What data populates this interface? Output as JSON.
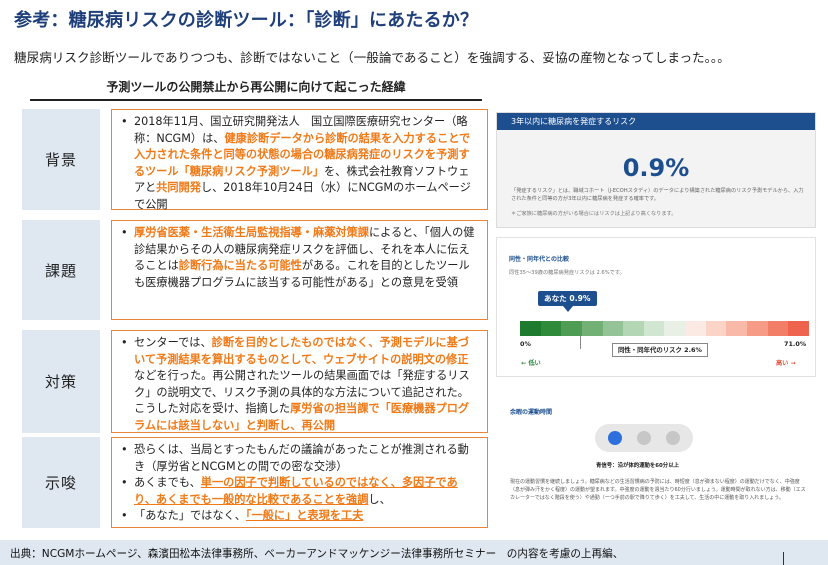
{
  "title": "参考：糖尿病リスクの診断ツール：「診断」にあたるか？",
  "subtitle": "糖尿病リスク診断ツールでありつつも、診断ではないこと（一般論であること）を強調する、妥協の産物となってしまった。。。",
  "section_heading": "予測ツールの公開禁止から再公開に向けて起こった経緯",
  "rows": [
    {
      "label": "背景",
      "text": [
        "2018年11月、国立研究開発法人　国立国際医療研究センター（略称：NCGM）は、",
        "健康診断データから診断の結果を入力することで入力された条件と同等の状態の場合の糖尿病発症のリスクを予測するツール「糖尿病リスク予測ツール」",
        "を、株式会社教育ソフトウェアと",
        "共同開発",
        "し、2018年10月24日（水）にNCGMのホームページで公開"
      ]
    },
    {
      "label": "課題",
      "text": [
        "厚労省医薬・生活衛生局監視指導・麻薬対策課",
        "によると、「個人の健診結果からその人の糖尿病発症リスクを評価し、それを本人に伝えることは",
        "診断行為に当たる可能性",
        "がある。これを目的としたツールも医療機器プログラムに該当する可能性がある」との意見を受領"
      ]
    },
    {
      "label": "対策",
      "text": [
        "センターでは、",
        "診断を目的としたものではなく、予測モデルに基づいて予測結果を算出するものとして、ウェブサイトの説明文の修正",
        "などを行った。再公開されたツールの結果画面では「発症するリスク」の説明文で、リスク予測の具体的な方法について追記された。こうした対応を受け、指摘した",
        "厚労省の担当課で「医療機器プログラムには該当しない」と判断し、再公開"
      ]
    },
    {
      "label": "示唆",
      "bullets": [
        [
          "恐らくは、当局とすったもんだの議論があったことが推測される動き（厚労省とNCGMとの間での密な交渉）"
        ],
        [
          "あくまでも、",
          "単一の因子で判断しているのではなく、多因子であり、あくまでも一般的な比較であることを強調",
          "し、"
        ],
        [
          "「あなた」ではなく、",
          "「一般に」と表現を工夫"
        ]
      ]
    }
  ],
  "risk_card": {
    "header": "3年以内に糖尿病を発症するリスク",
    "value": "0.9%",
    "description": "「発症するリスク」とは、職域コホート（J-ECOHスタディ）のデータにより構築された糖尿病のリスク予測モデルから、入力された条件と同等の方が3年以内に糖尿病を発症する確率です。",
    "note": "＊ご家族に糖尿病の方がいる場合にはリスクは上記より高くなります。"
  },
  "compare_card": {
    "title": "同性・同年代との比較",
    "description": "同性35〜39歳の糖尿病発症リスクは 2.6%です。",
    "you_label": "あなた 0.9%",
    "min_label": "0%",
    "max_label": "71.0%",
    "peer_label": "同性・同年代のリスク 2.6%",
    "low_label": "← 低い",
    "high_label": "高い →",
    "you_value_percent": 0.9,
    "peer_value_percent": 2.6,
    "scale_max_percent": 71.0,
    "colors": [
      "#1e7a2e",
      "#2f8a3a",
      "#4f9d55",
      "#72b076",
      "#93c396",
      "#b3d6b4",
      "#d1e6d1",
      "#e8f0e6",
      "#fbe9e3",
      "#fbd4c8",
      "#f9b9a8",
      "#f69b86",
      "#f27e67",
      "#ed634d"
    ]
  },
  "exercise_card": {
    "title": "余暇の運動時間",
    "caption": "青信号：沿が体的運動を60分以上",
    "detail": "現在の運動習慣を継続しましょう。糖尿病などの生活習慣病の予防には、時短度（息が弾まない程度）の運動だけでなく、中強度（息が弾み汗をかく程度）の運動が望まれます。中強度の運動を週当たり60分行いましょう。運動時間が取れない方は、移動（エスカレーターではなく階段を使う）や通勤（一つ手前の駅で降りて歩く）を工夫して、生活の中に運動を取り入れましょう。"
  },
  "footer": "出典：NCGMホームページ、森濱田松本法律事務所、ベーカーアンドマッケンジー法律事務所セミナー　の内容を考慮の上再編、"
}
